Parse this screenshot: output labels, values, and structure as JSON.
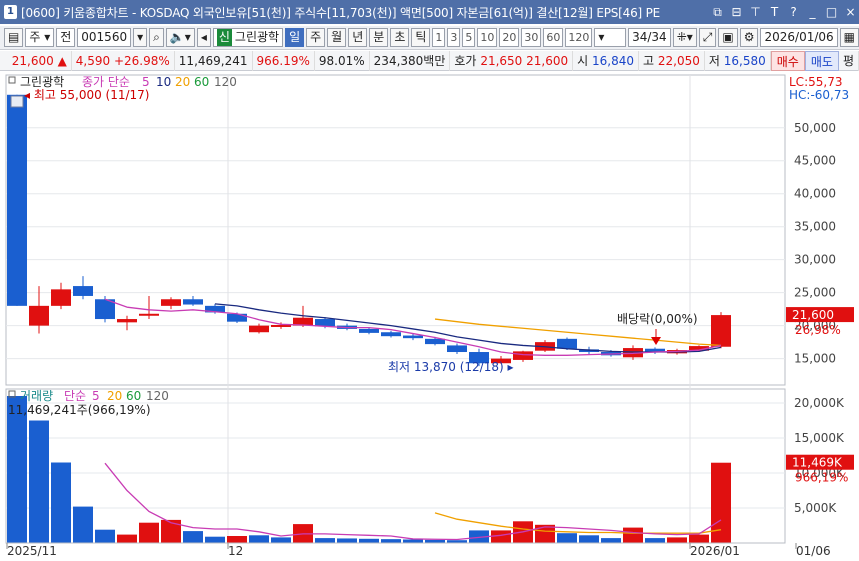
{
  "title": {
    "app_num": "1",
    "text": "[0600] 키움종합차트 - KOSDAQ 외국인보유[51(천)] 주식수[11,703(천)] 액면[500] 자본금[61(억)] 결산[12월] EPS[46] PE"
  },
  "window_controls": [
    "⧉",
    "⊟",
    "⊤",
    "T",
    "?",
    "_",
    "□",
    "×"
  ],
  "toolbar": {
    "type_label": "주",
    "market_label": "전",
    "code": "001560",
    "new_badge": "신",
    "stock_name": "그린광학",
    "periods": [
      "일",
      "주",
      "월",
      "년",
      "분",
      "초",
      "틱"
    ],
    "active_period": "일",
    "numbers": [
      "1",
      "3",
      "5",
      "10",
      "20",
      "30",
      "60",
      "120"
    ],
    "page": "34",
    "page_total": "/34",
    "date": "2026/01/06"
  },
  "info": {
    "price": "21,600",
    "change": "4,590",
    "change_pct": "+26.98%",
    "volume": "11,469,241",
    "vol_pct": "966.19%",
    "ratio": "98.01%",
    "amount": "234,380백만",
    "bid_label": "호가",
    "bid1": "21,650",
    "bid2": "21,600",
    "open_label": "시",
    "open": "16,840",
    "high_label": "고",
    "high": "22,050",
    "low_label": "저",
    "low": "16,580",
    "buy": "매수",
    "sell": "매도",
    "eval": "평"
  },
  "colors": {
    "up": "#e01010",
    "down": "#1a5fd0",
    "ma5": "#c83cb4",
    "ma10": "#1a2a80",
    "ma20": "#f0a000",
    "ma60": "#1a9a3a",
    "ma120": "#666666"
  },
  "chart_data": [
    {
      "type": "candlestick",
      "title": "그린광학",
      "legend": [
        "종가 단순",
        "5",
        "10",
        "20",
        "60",
        "120"
      ],
      "y_ticks": [
        "50,000",
        "45,000",
        "40,000",
        "35,000",
        "30,000",
        "25,000",
        "20,000",
        "15,000"
      ],
      "ylim": [
        11000,
        58000
      ],
      "lc": "LC:55,73",
      "hc": "HC:-60,73",
      "annotations": {
        "high": "최고 55,000 (11/17)",
        "low": "최저 13,870 (12/18)",
        "dividend": "배당락(0,00%)"
      },
      "last_price_label": "21,600",
      "last_pct_label": "26,98%",
      "candles": [
        {
          "o": 55000,
          "h": 55000,
          "l": 23000,
          "c": 23000
        },
        {
          "o": 20000,
          "h": 26000,
          "l": 18800,
          "c": 23000
        },
        {
          "o": 23000,
          "h": 26500,
          "l": 22500,
          "c": 25500
        },
        {
          "o": 26000,
          "h": 27500,
          "l": 24000,
          "c": 24500
        },
        {
          "o": 24000,
          "h": 24500,
          "l": 20500,
          "c": 21000
        },
        {
          "o": 20500,
          "h": 21500,
          "l": 19300,
          "c": 21000
        },
        {
          "o": 21500,
          "h": 24500,
          "l": 21000,
          "c": 21800
        },
        {
          "o": 23000,
          "h": 24300,
          "l": 22500,
          "c": 24000
        },
        {
          "o": 24000,
          "h": 24500,
          "l": 23000,
          "c": 23200
        },
        {
          "o": 23000,
          "h": 23300,
          "l": 21800,
          "c": 22000
        },
        {
          "o": 21800,
          "h": 22000,
          "l": 20400,
          "c": 20600
        },
        {
          "o": 19000,
          "h": 20300,
          "l": 18800,
          "c": 20000
        },
        {
          "o": 19800,
          "h": 20500,
          "l": 19500,
          "c": 20100
        },
        {
          "o": 20000,
          "h": 23000,
          "l": 19800,
          "c": 21200
        },
        {
          "o": 21000,
          "h": 21300,
          "l": 19600,
          "c": 19900
        },
        {
          "o": 20000,
          "h": 20300,
          "l": 19300,
          "c": 19500
        },
        {
          "o": 19500,
          "h": 19800,
          "l": 18700,
          "c": 18900
        },
        {
          "o": 19000,
          "h": 19200,
          "l": 18200,
          "c": 18400
        },
        {
          "o": 18500,
          "h": 18800,
          "l": 17800,
          "c": 18100
        },
        {
          "o": 18000,
          "h": 18300,
          "l": 17000,
          "c": 17200
        },
        {
          "o": 17000,
          "h": 17300,
          "l": 15700,
          "c": 16000
        },
        {
          "o": 16000,
          "h": 16500,
          "l": 13870,
          "c": 14300
        },
        {
          "o": 14300,
          "h": 15400,
          "l": 14200,
          "c": 15000
        },
        {
          "o": 14800,
          "h": 16200,
          "l": 14500,
          "c": 16100
        },
        {
          "o": 16200,
          "h": 17800,
          "l": 16000,
          "c": 17500
        },
        {
          "o": 18000,
          "h": 18200,
          "l": 16300,
          "c": 16500
        },
        {
          "o": 16400,
          "h": 16800,
          "l": 15700,
          "c": 16000
        },
        {
          "o": 16000,
          "h": 16300,
          "l": 15300,
          "c": 15500
        },
        {
          "o": 15200,
          "h": 17000,
          "l": 14800,
          "c": 16600
        },
        {
          "o": 16500,
          "h": 16700,
          "l": 15700,
          "c": 16000
        },
        {
          "o": 15800,
          "h": 16500,
          "l": 15600,
          "c": 16300
        },
        {
          "o": 16200,
          "h": 17000,
          "l": 16000,
          "c": 16900
        },
        {
          "o": 16800,
          "h": 22050,
          "l": 16580,
          "c": 21600
        }
      ],
      "ma5": [
        null,
        null,
        null,
        null,
        24000,
        22800,
        22400,
        22200,
        22400,
        22100,
        21800,
        20900,
        20200,
        20100,
        19900,
        19700,
        19700,
        19400,
        18800,
        18200,
        17500,
        16800,
        16000,
        15600,
        15500,
        15500,
        15600,
        15700,
        15800,
        16000,
        16100,
        16300,
        17000
      ],
      "ma10": [
        null,
        null,
        null,
        null,
        null,
        null,
        null,
        null,
        null,
        23300,
        23000,
        22400,
        21900,
        21500,
        21200,
        20800,
        20400,
        20000,
        19500,
        19000,
        18300,
        17800,
        17300,
        17000,
        16800,
        16500,
        16300,
        16100,
        16000,
        16000,
        16000,
        16100,
        16700
      ],
      "ma20": [
        null,
        null,
        null,
        null,
        null,
        null,
        null,
        null,
        null,
        null,
        null,
        null,
        null,
        null,
        null,
        null,
        null,
        null,
        null,
        21000,
        20600,
        20200,
        19900,
        19600,
        19300,
        19000,
        18700,
        18400,
        18100,
        17800,
        17500,
        17200,
        17000
      ]
    },
    {
      "type": "bar",
      "title": "거래량",
      "legend": [
        "단순",
        "5",
        "20",
        "60",
        "120"
      ],
      "volume_label": "11,469,241주(966,19%)",
      "y_ticks": [
        "20,000K",
        "15,000K",
        "10,000K",
        "5,000K"
      ],
      "ylim": [
        0,
        22000
      ],
      "last_vol_label": "11,469K",
      "last_pct_label": "966,19%",
      "x_labels": [
        "2025/11",
        "12",
        "2026/01",
        "01/06"
      ],
      "values": [
        21000,
        17500,
        11500,
        5200,
        1900,
        1200,
        2900,
        3300,
        1700,
        900,
        1000,
        1100,
        800,
        2700,
        700,
        650,
        600,
        550,
        500,
        450,
        400,
        1800,
        1800,
        3100,
        2600,
        1400,
        1100,
        700,
        2200,
        700,
        800,
        1200,
        11469
      ],
      "up": [
        false,
        false,
        false,
        false,
        false,
        true,
        true,
        true,
        false,
        false,
        true,
        false,
        false,
        true,
        false,
        false,
        false,
        false,
        false,
        false,
        false,
        false,
        true,
        true,
        true,
        false,
        false,
        false,
        true,
        false,
        true,
        true,
        true
      ],
      "ma5": [
        null,
        null,
        null,
        null,
        11400,
        7500,
        4500,
        2900,
        2200,
        2000,
        2000,
        1600,
        1000,
        1300,
        1300,
        1200,
        1100,
        1000,
        580,
        540,
        500,
        800,
        1100,
        1600,
        2300,
        2200,
        2000,
        1800,
        1500,
        1300,
        1200,
        1300,
        3300
      ],
      "ma20": [
        null,
        null,
        null,
        null,
        null,
        null,
        null,
        null,
        null,
        null,
        null,
        null,
        null,
        null,
        null,
        null,
        null,
        null,
        null,
        4300,
        3400,
        2900,
        2400,
        2000,
        1700,
        1600,
        1500,
        1500,
        1400,
        1400,
        1400,
        1400,
        1900
      ]
    }
  ]
}
